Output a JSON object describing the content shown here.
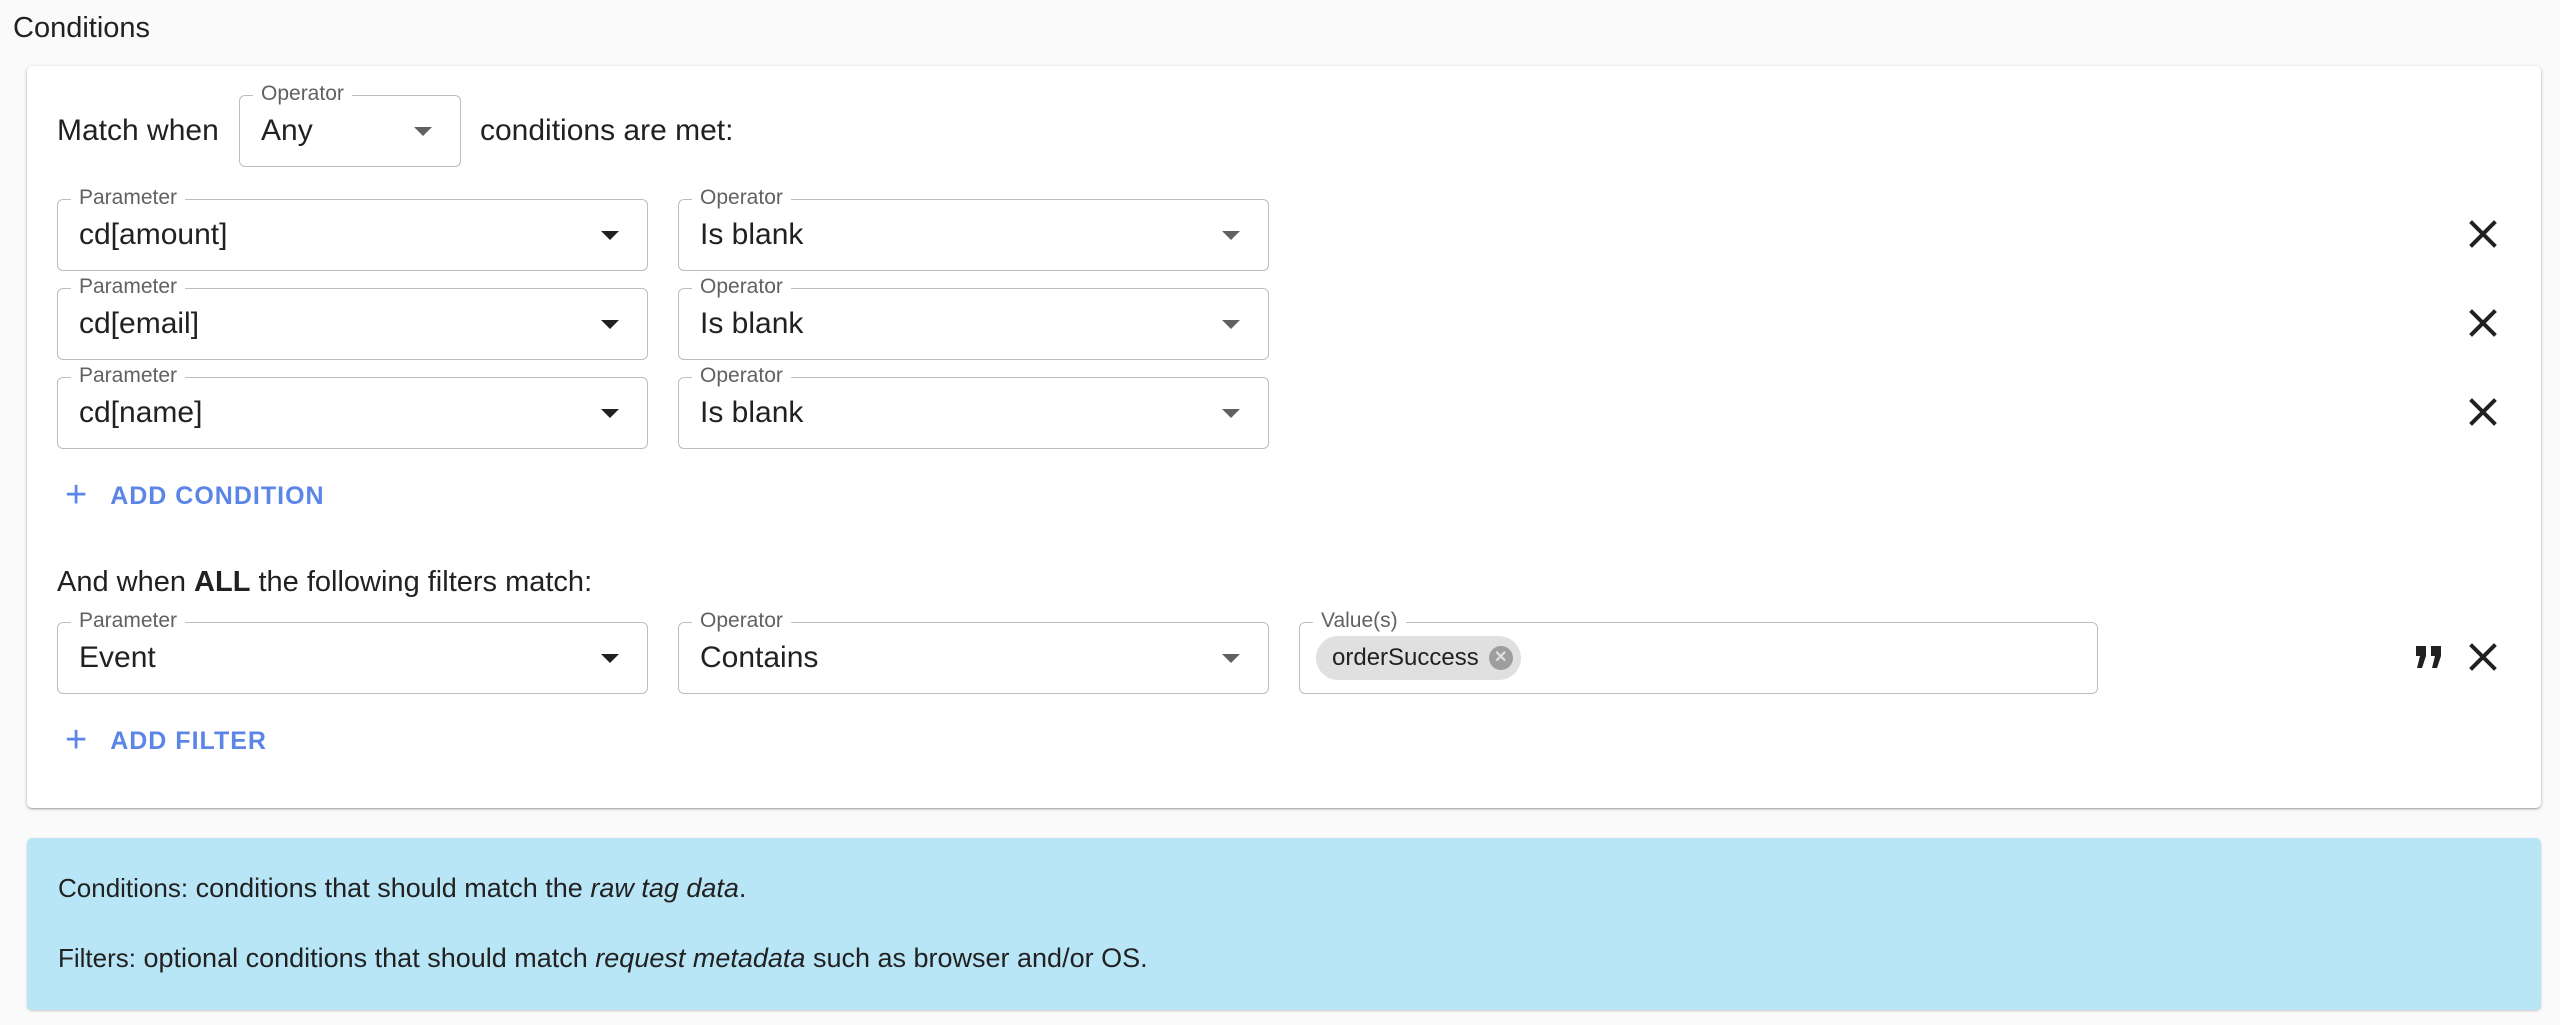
{
  "section_title": "Conditions",
  "match": {
    "prefix": "Match when",
    "operator_legend": "Operator",
    "operator_value": "Any",
    "suffix": "conditions are met:"
  },
  "conditions": [
    {
      "param_legend": "Parameter",
      "param_value": "cd[amount]",
      "op_legend": "Operator",
      "op_value": "Is blank"
    },
    {
      "param_legend": "Parameter",
      "param_value": "cd[email]",
      "op_legend": "Operator",
      "op_value": "Is blank"
    },
    {
      "param_legend": "Parameter",
      "param_value": "cd[name]",
      "op_legend": "Operator",
      "op_value": "Is blank"
    }
  ],
  "add_condition_label": "ADD CONDITION",
  "filters_heading": {
    "prefix": "And when ",
    "emphasis": "ALL",
    "suffix": " the following filters match:"
  },
  "filter": {
    "param_legend": "Parameter",
    "param_value": "Event",
    "op_legend": "Operator",
    "op_value": "Contains",
    "values_legend": "Value(s)",
    "chips": [
      "orderSuccess"
    ]
  },
  "add_filter_label": "ADD FILTER",
  "info": {
    "conditions_term": "Conditions:",
    "conditions_text": " conditions that should match the ",
    "conditions_italic": "raw tag data",
    "conditions_end": ".",
    "filters_term": "Filters:",
    "filters_text": " optional conditions that should match ",
    "filters_italic": "request metadata",
    "filters_end": " such as browser and/or OS."
  },
  "icons": {
    "close": "close-icon",
    "quote": "format-quote-icon",
    "plus": "plus-icon",
    "dropdown": "arrow-drop-down-icon",
    "chip_remove": "cancel-circle-icon"
  },
  "colors": {
    "accent": "#5c85e8",
    "info_background": "#b9e6f6",
    "chip_background": "#e0e0e0"
  }
}
